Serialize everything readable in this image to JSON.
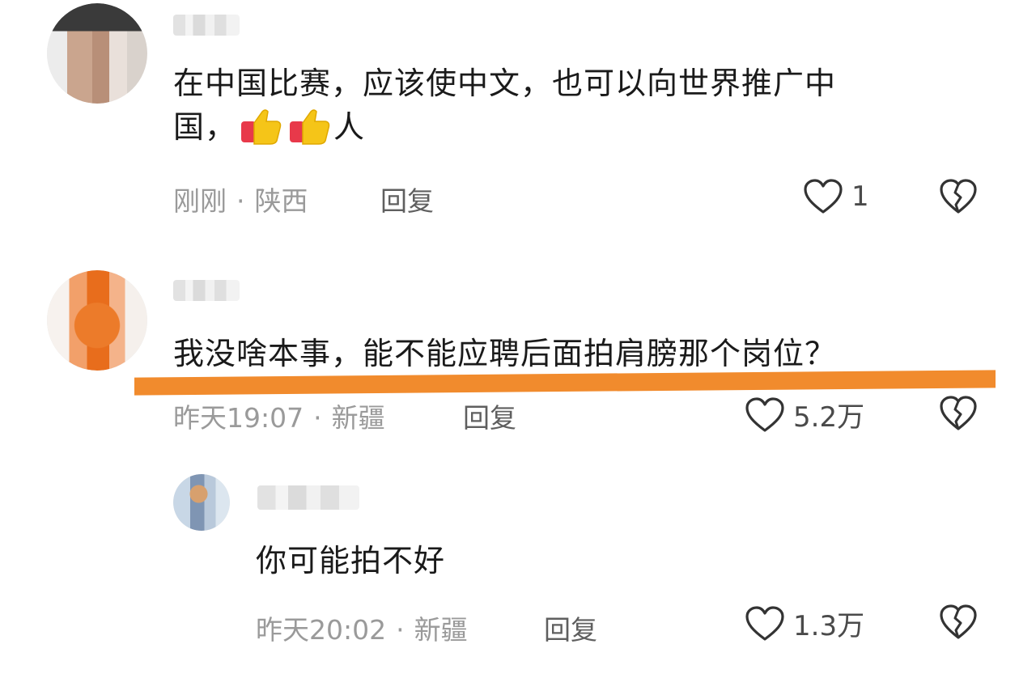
{
  "comments": [
    {
      "text_line1": "在中国比赛，应该使中文，也可以向世界推广中",
      "text_line2_a": "国，",
      "text_line2_b": "人",
      "time": "刚刚",
      "location": "陕西",
      "reply_label": "回复",
      "like_count": "1"
    },
    {
      "text": "我没啥本事，能不能应聘后面拍肩膀那个岗位？",
      "time": "昨天19:07",
      "location": "新疆",
      "reply_label": "回复",
      "like_count": "5.2万"
    },
    {
      "text": "你可能拍不好",
      "time": "昨天20:02",
      "location": "新疆",
      "reply_label": "回复",
      "like_count": "1.3万"
    }
  ],
  "separator": "·",
  "icons": {
    "like": "heart-outline-icon",
    "dislike": "broken-heart-icon",
    "emoji": "thumbs-up-emoji"
  },
  "colors": {
    "highlight_line": "#f08522",
    "meta_text": "#9a9a9a"
  }
}
